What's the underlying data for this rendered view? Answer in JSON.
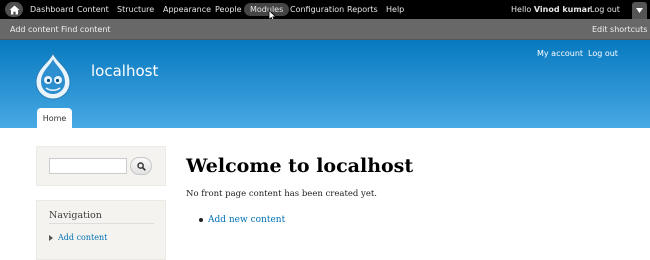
{
  "toolbar": {
    "items": [
      {
        "label": "Dashboard"
      },
      {
        "label": "Content"
      },
      {
        "label": "Structure"
      },
      {
        "label": "Appearance"
      },
      {
        "label": "People"
      },
      {
        "label": "Modules",
        "active": true
      },
      {
        "label": "Configuration"
      },
      {
        "label": "Reports"
      },
      {
        "label": "Help"
      }
    ],
    "hello_prefix": "Hello",
    "user_name": "Vinod kumar",
    "logout": "Log out",
    "icons": {
      "home": "home-icon",
      "drawer": "chevron-down-icon"
    }
  },
  "shortcuts": {
    "add_content": "Add content",
    "find_content": "Find content",
    "edit_shortcuts": "Edit shortcuts"
  },
  "header": {
    "site_name": "localhost",
    "my_account": "My account",
    "logout": "Log out",
    "home_tab": "Home",
    "logo": "drupal-drop-logo",
    "gradient_top": "#0779bf",
    "gradient_bottom": "#48a9e4"
  },
  "sidebar": {
    "search": {
      "placeholder": "",
      "value": "",
      "button_icon": "search-icon"
    },
    "navigation": {
      "title": "Navigation",
      "items": [
        {
          "label": "Add content"
        }
      ]
    }
  },
  "main": {
    "title": "Welcome to localhost",
    "message": "No front page content has been created yet.",
    "links": [
      {
        "label": "Add new content"
      }
    ]
  },
  "colors": {
    "link": "#0071b3",
    "toolbar_bg": "#000000",
    "shortcuts_bg": "#686868"
  }
}
